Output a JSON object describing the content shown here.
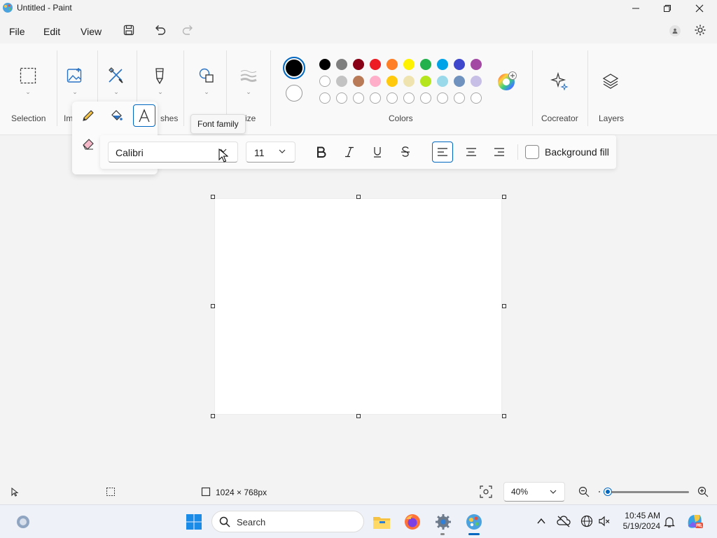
{
  "window": {
    "title": "Untitled - Paint"
  },
  "menu": {
    "file": "File",
    "edit": "Edit",
    "view": "View"
  },
  "ribbon": {
    "selection_label": "Selection",
    "image_label": "Im",
    "brushes_label": "shes",
    "size_label": "ize",
    "colors_label": "Colors",
    "cocreator_label": "Cocreator",
    "layers_label": "Layers"
  },
  "colors": {
    "row1": [
      "#000000",
      "#7f7f7f",
      "#880015",
      "#ed1c24",
      "#ff7f27",
      "#fff200",
      "#22b14c",
      "#00a2e8",
      "#3f48cc",
      "#a349a4"
    ],
    "row2": [
      "#ffffff",
      "#c3c3c3",
      "#b97a57",
      "#ffaec9",
      "#ffc90e",
      "#efe4b0",
      "#b5e61d",
      "#99d9ea",
      "#7092be",
      "#c8bfe7"
    ],
    "primary": "#000000",
    "secondary": "#ffffff"
  },
  "tooltip": {
    "text": "Font family"
  },
  "text_format": {
    "font_family": "Calibri",
    "font_size": "11",
    "background_fill": "Background fill"
  },
  "status": {
    "canvas_size": "1024 × 768px",
    "zoom": "40%",
    "zoom_slider_fraction": 0.05
  },
  "taskbar": {
    "search_placeholder": "Search",
    "time": "10:45 AM",
    "date": "5/19/2024"
  }
}
